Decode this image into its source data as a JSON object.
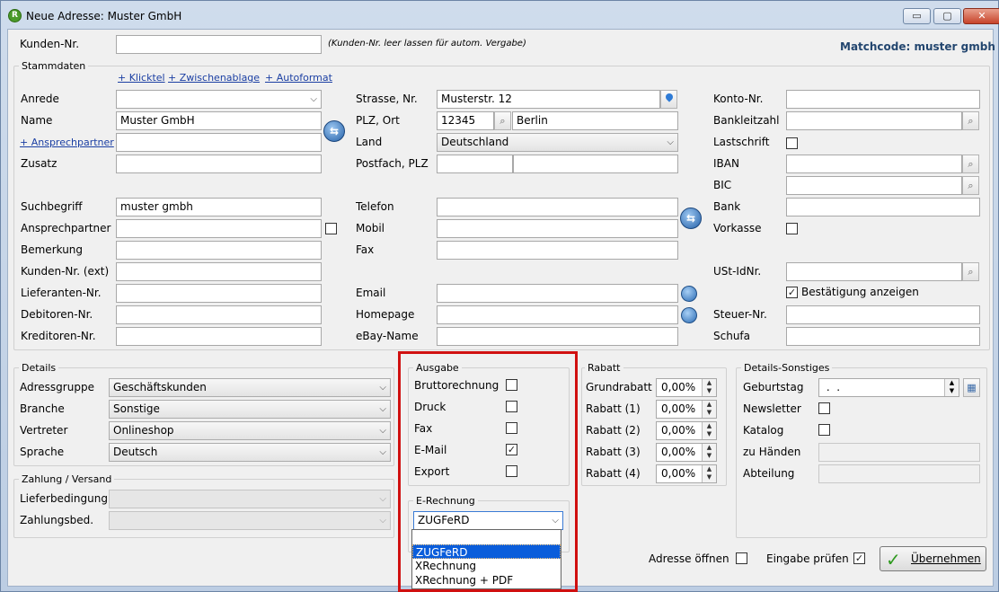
{
  "window": {
    "title": "Neue Adresse: Muster GmbH",
    "minimize": "▭",
    "maximize": "▢",
    "close": "✕"
  },
  "top": {
    "kundennr_label": "Kunden-Nr.",
    "kundennr_value": "",
    "kundennr_hint": "(Kunden-Nr. leer lassen für autom. Vergabe)",
    "matchcode": "Matchcode: muster gmbh"
  },
  "stammdaten": {
    "group_label": "Stammdaten",
    "links": {
      "klicktel": "+ Klicktel",
      "zwischenablage": "+ Zwischenablage",
      "autoformat": "+ Autoformat",
      "ansprechpartner": "+ Ansprechpartner"
    },
    "anrede_label": "Anrede",
    "anrede_value": "",
    "name_label": "Name",
    "name_value": "Muster GmbH",
    "name2_value": "",
    "zusatz_label": "Zusatz",
    "zusatz_value": "",
    "suchbegriff_label": "Suchbegriff",
    "suchbegriff_value": "muster gmbh",
    "ansprechpartner_label": "Ansprechpartner",
    "ansprechpartner_value": "",
    "bemerkung_label": "Bemerkung",
    "bemerkung_value": "",
    "kundennr_ext_label": "Kunden-Nr. (ext)",
    "kundennr_ext_value": "",
    "lieferanten_label": "Lieferanten-Nr.",
    "lieferanten_value": "",
    "debitoren_label": "Debitoren-Nr.",
    "debitoren_value": "",
    "kreditoren_label": "Kreditoren-Nr.",
    "kreditoren_value": "",
    "strasse_label": "Strasse, Nr.",
    "strasse_value": "Musterstr. 12",
    "plzort_label": "PLZ, Ort",
    "plz_value": "12345",
    "ort_value": "Berlin",
    "land_label": "Land",
    "land_value": "Deutschland",
    "postfach_label": "Postfach, PLZ",
    "postfach_value": "",
    "postfach_plz_value": "",
    "telefon_label": "Telefon",
    "telefon_value": "",
    "mobil_label": "Mobil",
    "mobil_value": "",
    "fax_label": "Fax",
    "fax_value": "",
    "email_label": "Email",
    "email_value": "",
    "homepage_label": "Homepage",
    "homepage_value": "",
    "ebay_label": "eBay-Name",
    "ebay_value": "",
    "konto_label": "Konto-Nr.",
    "konto_value": "",
    "blz_label": "Bankleitzahl",
    "blz_value": "",
    "lastschrift_label": "Lastschrift",
    "lastschrift_checked": false,
    "iban_label": "IBAN",
    "iban_value": "",
    "bic_label": "BIC",
    "bic_value": "",
    "bank_label": "Bank",
    "bank_value": "",
    "vorkasse_label": "Vorkasse",
    "vorkasse_checked": false,
    "ustid_label": "USt-IdNr.",
    "ustid_value": "",
    "bestaetigung_label": "Bestätigung anzeigen",
    "bestaetigung_checked": true,
    "steuer_label": "Steuer-Nr.",
    "steuer_value": "",
    "schufa_label": "Schufa",
    "schufa_value": ""
  },
  "details": {
    "group_label": "Details",
    "adressgruppe_label": "Adressgruppe",
    "adressgruppe_value": "Geschäftskunden",
    "branche_label": "Branche",
    "branche_value": "Sonstige",
    "vertreter_label": "Vertreter",
    "vertreter_value": "Onlineshop",
    "sprache_label": "Sprache",
    "sprache_value": "Deutsch"
  },
  "zahlung": {
    "group_label": "Zahlung / Versand",
    "liefer_label": "Lieferbedingung",
    "liefer_value": "",
    "zahlungsbed_label": "Zahlungsbed.",
    "zahlungsbed_value": ""
  },
  "ausgabe": {
    "group_label": "Ausgabe",
    "items": [
      {
        "label": "Bruttorechnung",
        "checked": false,
        "mark": ""
      },
      {
        "label": "Druck",
        "checked": false,
        "mark": ""
      },
      {
        "label": "Fax",
        "checked": false,
        "mark": ""
      },
      {
        "label": "E-Mail",
        "checked": true,
        "mark": "✓"
      },
      {
        "label": "Export",
        "checked": false,
        "mark": ""
      }
    ]
  },
  "erechnung": {
    "group_label": "E-Rechnung",
    "selected": "ZUGFeRD",
    "options": [
      "",
      "ZUGFeRD",
      "XRechnung",
      "XRechnung + PDF"
    ]
  },
  "rabatt": {
    "group_label": "Rabatt",
    "items": [
      {
        "label": "Grundrabatt",
        "value": "0,00%"
      },
      {
        "label": "Rabatt (1)",
        "value": "0,00%"
      },
      {
        "label": "Rabatt (2)",
        "value": "0,00%"
      },
      {
        "label": "Rabatt (3)",
        "value": "0,00%"
      },
      {
        "label": "Rabatt (4)",
        "value": "0,00%"
      }
    ]
  },
  "sonstiges": {
    "group_label": "Details-Sonstiges",
    "geburtstag_label": "Geburtstag",
    "geburtstag_value": " .  .",
    "newsletter_label": "Newsletter",
    "newsletter_checked": false,
    "katalog_label": "Katalog",
    "katalog_checked": false,
    "zuhaenden_label": "zu Händen",
    "zuhaenden_value": "",
    "abteilung_label": "Abteilung",
    "abteilung_value": ""
  },
  "footer": {
    "adresse_oeffnen_label": "Adresse öffnen",
    "adresse_oeffnen_checked": false,
    "eingabe_pruefen_label": "Eingabe prüfen",
    "eingabe_pruefen_checked": true,
    "uebernehmen_label": "Übernehmen"
  },
  "colors": {
    "highlight": "#d01010",
    "selection": "#0a5ddb",
    "accent": "#23466f"
  },
  "icons": {
    "dropdown": "⌵",
    "search": "⌕",
    "check": "✓",
    "spin_up": "▲",
    "spin_down": "▼",
    "sync": "⇆",
    "calendar": "▦"
  }
}
